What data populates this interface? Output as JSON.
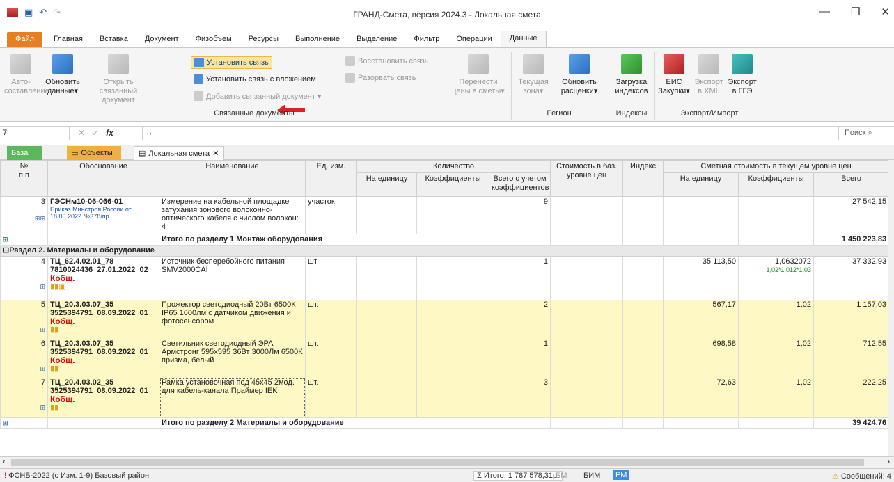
{
  "window": {
    "title": "ГРАНД-Смета, версия 2024.3 - Локальная смета"
  },
  "menu": [
    "Главная",
    "Вставка",
    "Документ",
    "Физобъем",
    "Ресурсы",
    "Выполнение",
    "Выделение",
    "Фильтр",
    "Операции",
    "Данные"
  ],
  "menu_file": "Файл",
  "ribbon": {
    "auto": "Авто-\nсоставление",
    "update_data": "Обновить\nданные▾",
    "open_linked": "Открыть связанный\nдокумент",
    "set_link": "Установить связь",
    "set_link_nested": "Установить связь с вложением",
    "add_linked": "Добавить связанный документ ▾",
    "restore_link": "Восстановить связь",
    "break_link": "Разорвать связь",
    "transfer": "Перенести\nцены в сметы▾",
    "current_zone": "Текущая\nзона▾",
    "update_prices": "Обновить\nрасценки▾",
    "load_indexes": "Загрузка\nиндексов",
    "eis": "ЕИС\nЗакупки▾",
    "export_xml": "Экспорт\nв XML",
    "export_gge": "Экспорт\nв ГГЭ",
    "group_linked": "Связанные документы",
    "group_region": "Регион",
    "group_indexes": "Индексы",
    "group_export": "Экспорт/Импорт"
  },
  "formula": {
    "cell": "7",
    "value": "↔",
    "search": "Поиск"
  },
  "tabs": {
    "base": "База",
    "objects": "Объекты",
    "doc": "Локальная смета"
  },
  "headers": {
    "num": "№\nп.п",
    "basis": "Обоснование",
    "name": "Наименование",
    "unit": "Ед. изм.",
    "qty": "Количество",
    "qty_unit": "На единицу",
    "qty_coef": "Коэффициенты",
    "qty_total": "Всего с учетом\nкоэффициентов",
    "base_cost": "Стоимость в баз.\nуровне цен",
    "index": "Индекс",
    "cur_cost": "Сметная стоимость в текущем уровне цен",
    "cur_unit": "На единицу",
    "cur_coef": "Коэффициенты",
    "cur_total": "Всего"
  },
  "rows": {
    "r3": {
      "num": "3",
      "code": "ГЭСНм10-06-066-01",
      "ref": "Приказ Минстроя России от 18.05.2022 №378/пр",
      "name": "Измерение на кабельной площадке затухания зонового волоконно-оптического кабеля с числом волокон: 4",
      "unit": "участок",
      "qty": "9",
      "total": "27 542,15"
    },
    "t1": {
      "label": "Итого по разделу 1 Монтаж оборудования",
      "total": "1 450 223,83"
    },
    "s2": "Раздел 2. Материалы и оборудование",
    "r4": {
      "num": "4",
      "code": "ТЦ_62.4.02.01_78 7810024436_27.01.2022_02",
      "k": "Кобщ.",
      "name": "Источник бесперебойного питания SMV2000CAI",
      "unit": "шт",
      "qty": "1",
      "unitcost": "35 113,50",
      "coef": "1,0632072",
      "coefsub": "1,02*1,012*1,03",
      "total": "37 332,93"
    },
    "r5": {
      "num": "5",
      "code": "ТЦ_20.3.03.07_35 3525394791_08.09.2022_01",
      "k": "Кобщ.",
      "name": "Прожектор светодиодный 20Вт 6500К IP65 1600лм с датчиком движения и фотосенсором",
      "unit": "шт.",
      "qty": "2",
      "unitcost": "567,17",
      "coef": "1,02",
      "total": "1 157,03"
    },
    "r6": {
      "num": "6",
      "code": "ТЦ_20.3.03.07_35 3525394791_08.09.2022_01",
      "k": "Кобщ.",
      "name": "Светильник светодиодный ЭРА Армстронг 595х595 36Вт 3000Лм 6500К призма, белый",
      "unit": "шт.",
      "qty": "1",
      "unitcost": "698,58",
      "coef": "1,02",
      "total": "712,55"
    },
    "r7": {
      "num": "7",
      "code": "ТЦ_20.4.03.02_35 3525394791_08.09.2022_01",
      "k": "Кобщ.",
      "name": "Рамка установочная под 45х45 2мод. для кабель-канала Праймер IEK",
      "unit": "шт.",
      "qty": "3",
      "unitcost": "72,63",
      "coef": "1,02",
      "total": "222,25"
    },
    "t2": {
      "label": "Итого по разделу 2 Материалы и оборудование",
      "total": "39 424,76"
    }
  },
  "status": {
    "left": "ФСНБ-2022 (с Изм. 1-9)  Базовый район",
    "total": "Итого: 1 787 578,31р.",
    "bm": "БМ",
    "bim": "БИМ",
    "rm": "РМ",
    "messages": "Сообщений: 4"
  }
}
